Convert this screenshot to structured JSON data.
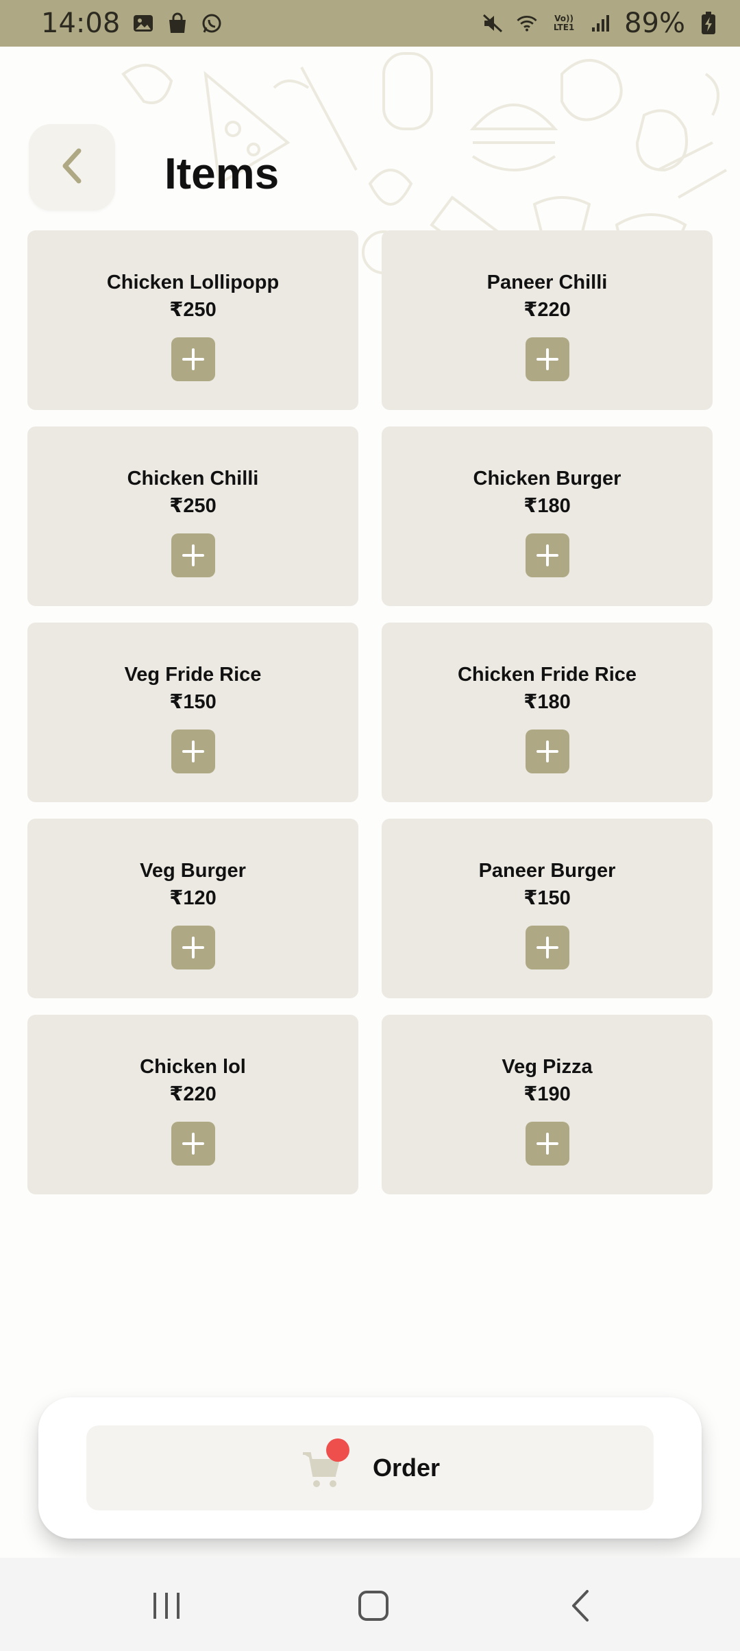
{
  "status_bar": {
    "time": "14:08",
    "left_icons": [
      "gallery-icon",
      "shopping-bag-icon",
      "whatsapp-icon"
    ],
    "right_icons": [
      "mute-icon",
      "wifi-icon",
      "volte-icon",
      "signal-icon",
      "battery-charging-icon"
    ],
    "volte_text": "Vo)) LTE1",
    "battery": "89%"
  },
  "header": {
    "back_icon": "chevron-left-icon",
    "title": "Items"
  },
  "items": [
    {
      "name": "Chicken Lollipopp",
      "price": "₹250"
    },
    {
      "name": "Paneer Chilli",
      "price": "₹220"
    },
    {
      "name": "Chicken Chilli",
      "price": "₹250"
    },
    {
      "name": "Chicken Burger",
      "price": "₹180"
    },
    {
      "name": "Veg Fride Rice",
      "price": "₹150"
    },
    {
      "name": "Chicken Fride Rice",
      "price": "₹180"
    },
    {
      "name": "Veg Burger",
      "price": "₹120"
    },
    {
      "name": "Paneer Burger",
      "price": "₹150"
    },
    {
      "name": "Chicken lol",
      "price": "₹220"
    },
    {
      "name": "Veg Pizza",
      "price": "₹190"
    }
  ],
  "add_icon": "plus-icon",
  "order": {
    "label": "Order",
    "icon": "cart-icon"
  },
  "nav_bar": {
    "recents_icon": "recents-icon",
    "home_icon": "home-icon",
    "back_icon": "back-icon"
  },
  "colors": {
    "accent": "#aea984",
    "card_bg": "#ebe9e2",
    "badge": "#ef4f4c"
  }
}
